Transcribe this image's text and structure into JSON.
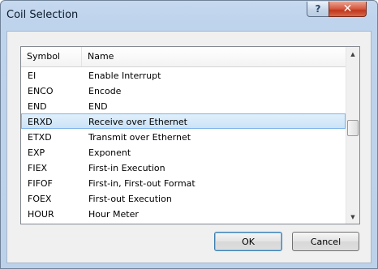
{
  "window": {
    "title": "Coil Selection",
    "help_glyph": "?",
    "close_glyph": "✕"
  },
  "list": {
    "columns": [
      "Symbol",
      "Name"
    ],
    "rows": [
      {
        "symbol": "EI",
        "name": "Enable Interrupt"
      },
      {
        "symbol": "ENCO",
        "name": "Encode"
      },
      {
        "symbol": "END",
        "name": "END"
      },
      {
        "symbol": "ERXD",
        "name": "Receive over Ethernet"
      },
      {
        "symbol": "ETXD",
        "name": "Transmit over Ethernet"
      },
      {
        "symbol": "EXP",
        "name": "Exponent"
      },
      {
        "symbol": "FIEX",
        "name": "First-in Execution"
      },
      {
        "symbol": "FIFOF",
        "name": "First-in, First-out Format"
      },
      {
        "symbol": "FOEX",
        "name": "First-out Execution"
      },
      {
        "symbol": "HOUR",
        "name": "Hour Meter"
      }
    ],
    "selected_index": 3
  },
  "buttons": {
    "ok_label": "OK",
    "cancel_label": "Cancel"
  },
  "icons": {
    "scroll_up": "up-arrow-icon",
    "scroll_down": "down-arrow-icon"
  }
}
